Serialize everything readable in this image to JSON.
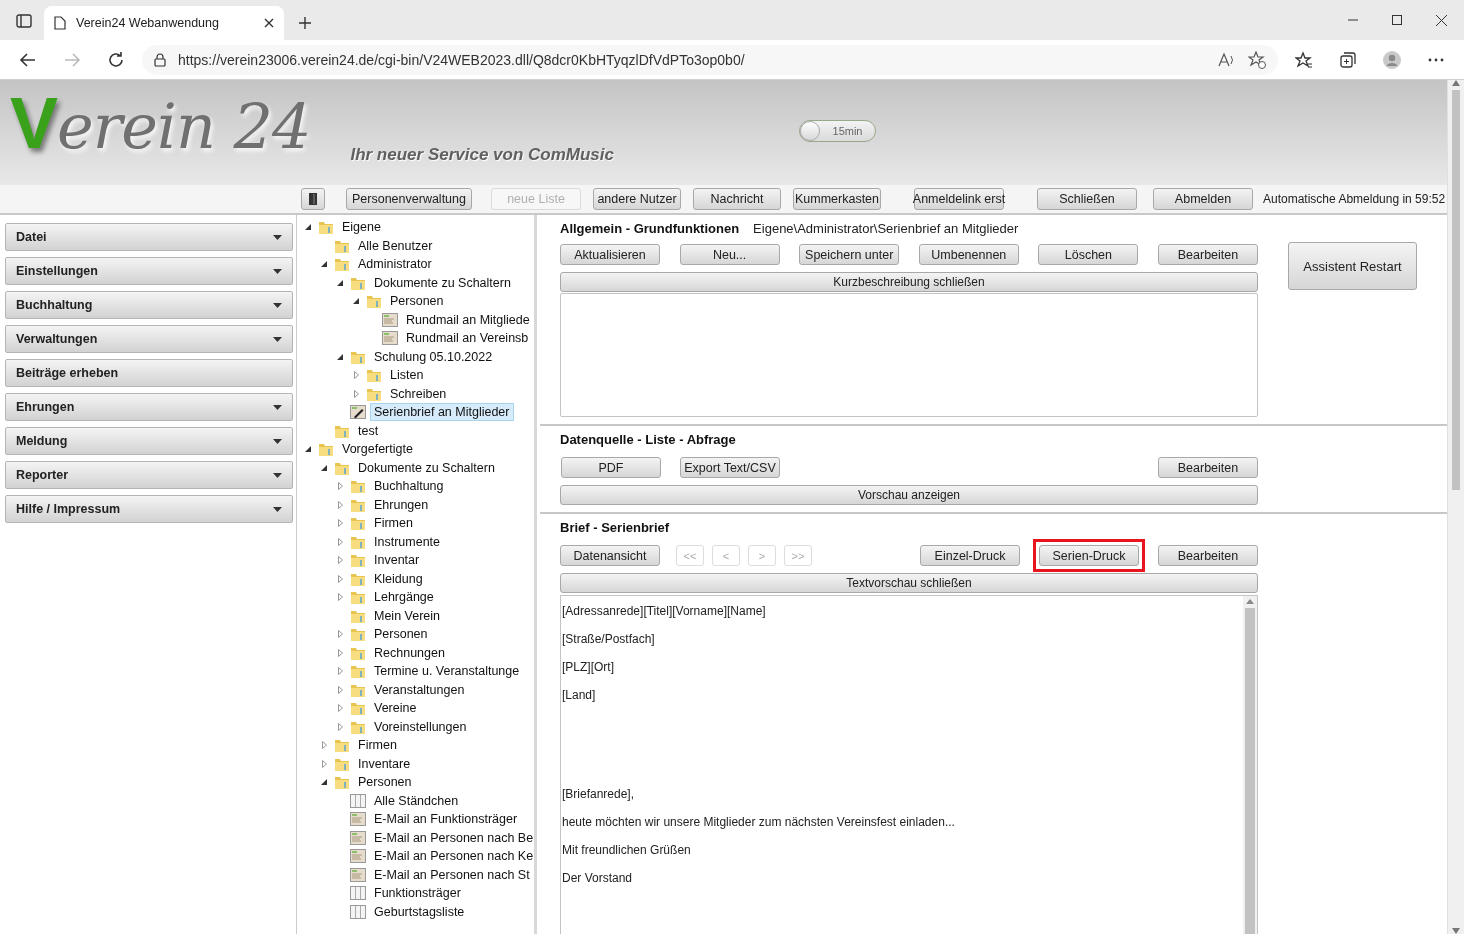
{
  "browser": {
    "tab_title": "Verein24 Webanwendung",
    "url": "https://verein23006.verein24.de/cgi-bin/V24WEB2023.dll/Q8dcr0KbHTyqzlDfVdPTo3op0b0/"
  },
  "header": {
    "logo_initial": "V",
    "logo_rest": "erein 24",
    "tagline": "Ihr neuer Service von ComMusic",
    "timeout_toggle": {
      "label": "15min",
      "on": false
    }
  },
  "toolbar": {
    "buttons": [
      {
        "kind": "icon",
        "disabled": false
      },
      {
        "kind": "text",
        "label": "Personenverwaltung",
        "disabled": false
      },
      {
        "kind": "text",
        "label": "neue Liste",
        "disabled": true
      },
      {
        "kind": "text",
        "label": "andere Nutzer",
        "disabled": false
      },
      {
        "kind": "text",
        "label": "Nachricht",
        "disabled": false
      },
      {
        "kind": "text",
        "label": "Kummerkasten",
        "disabled": false
      },
      {
        "kind": "text",
        "label": "Anmeldelink erst",
        "disabled": false
      },
      {
        "kind": "text",
        "label": "Schließen",
        "disabled": false
      },
      {
        "kind": "text",
        "label": "Abmelden",
        "disabled": false
      }
    ],
    "auto_logout": "Automatische Abmeldung in 59:52"
  },
  "menu": [
    {
      "label": "Datei",
      "has_submenu": true
    },
    {
      "label": "Einstellungen",
      "has_submenu": true
    },
    {
      "label": "Buchhaltung",
      "has_submenu": true
    },
    {
      "label": "Verwaltungen",
      "has_submenu": true
    },
    {
      "label": "Beiträge erheben",
      "has_submenu": false
    },
    {
      "label": "Ehrungen",
      "has_submenu": true
    },
    {
      "label": "Meldung",
      "has_submenu": true
    },
    {
      "label": "Reporter",
      "has_submenu": true
    },
    {
      "label": "Hilfe / Impressum",
      "has_submenu": true
    }
  ],
  "tree": [
    {
      "label": "Eigene",
      "kind": "folder",
      "expanded": true,
      "selected": false,
      "children": [
        {
          "label": "Alle Benutzer",
          "kind": "folder",
          "selected": false
        },
        {
          "label": "Administrator",
          "kind": "folder",
          "expanded": true,
          "selected": false,
          "children": [
            {
              "label": "Dokumente zu Schaltern",
              "kind": "folder",
              "expanded": true,
              "selected": false,
              "children": [
                {
                  "label": "Personen",
                  "kind": "folder",
                  "expanded": true,
                  "selected": false,
                  "children": [
                    {
                      "label": "Rundmail an Mitgliede",
                      "kind": "mail-template",
                      "selected": false
                    },
                    {
                      "label": "Rundmail an Vereinsb",
                      "kind": "mail-template",
                      "selected": false
                    }
                  ]
                }
              ]
            },
            {
              "label": "Schulung 05.10.2022",
              "kind": "folder",
              "expanded": true,
              "selected": false,
              "children": [
                {
                  "label": "Listen",
                  "kind": "folder",
                  "expanded": false,
                  "selected": false
                },
                {
                  "label": "Schreiben",
                  "kind": "folder",
                  "expanded": false,
                  "selected": false
                }
              ]
            },
            {
              "label": "Serienbrief an Mitglieder",
              "kind": "letter-edit",
              "selected": true
            }
          ]
        },
        {
          "label": "test",
          "kind": "folder",
          "selected": false
        }
      ]
    },
    {
      "label": "Vorgefertigte",
      "kind": "folder",
      "expanded": true,
      "selected": false,
      "children": [
        {
          "label": "Dokumente zu Schaltern",
          "kind": "folder",
          "expanded": true,
          "selected": false,
          "children": [
            {
              "label": "Buchhaltung",
              "kind": "folder",
              "expanded": false,
              "selected": false
            },
            {
              "label": "Ehrungen",
              "kind": "folder",
              "expanded": false,
              "selected": false
            },
            {
              "label": "Firmen",
              "kind": "folder",
              "expanded": false,
              "selected": false
            },
            {
              "label": "Instrumente",
              "kind": "folder",
              "expanded": false,
              "selected": false
            },
            {
              "label": "Inventar",
              "kind": "folder",
              "expanded": false,
              "selected": false
            },
            {
              "label": "Kleidung",
              "kind": "folder",
              "expanded": false,
              "selected": false
            },
            {
              "label": "Lehrgänge",
              "kind": "folder",
              "expanded": false,
              "selected": false
            },
            {
              "label": "Mein Verein",
              "kind": "folder",
              "selected": false
            },
            {
              "label": "Personen",
              "kind": "folder",
              "expanded": false,
              "selected": false
            },
            {
              "label": "Rechnungen",
              "kind": "folder",
              "expanded": false,
              "selected": false
            },
            {
              "label": "Termine u. Veranstaltunge",
              "kind": "folder",
              "expanded": false,
              "selected": false
            },
            {
              "label": "Veranstaltungen",
              "kind": "folder",
              "expanded": false,
              "selected": false
            },
            {
              "label": "Vereine",
              "kind": "folder",
              "expanded": false,
              "selected": false
            },
            {
              "label": "Voreinstellungen",
              "kind": "folder",
              "expanded": false,
              "selected": false
            }
          ]
        },
        {
          "label": "Firmen",
          "kind": "folder",
          "expanded": false,
          "selected": false
        },
        {
          "label": "Inventare",
          "kind": "folder",
          "expanded": false,
          "selected": false
        },
        {
          "label": "Personen",
          "kind": "folder",
          "expanded": true,
          "selected": false,
          "children": [
            {
              "label": "Alle Ständchen",
              "kind": "list",
              "selected": false
            },
            {
              "label": "E-Mail an Funktionsträger",
              "kind": "mail-template",
              "selected": false
            },
            {
              "label": "E-Mail an Personen nach Be",
              "kind": "mail-template",
              "selected": false
            },
            {
              "label": "E-Mail an Personen nach Ke",
              "kind": "mail-template",
              "selected": false
            },
            {
              "label": "E-Mail an Personen nach St",
              "kind": "mail-template",
              "selected": false
            },
            {
              "label": "Funktionsträger",
              "kind": "list",
              "selected": false
            },
            {
              "label": "Geburtstagsliste",
              "kind": "list",
              "selected": false
            }
          ]
        }
      ]
    }
  ],
  "general": {
    "title": "Allgemein - Grundfunktionen",
    "path": "Eigene\\Administrator\\Serienbrief an Mitglieder",
    "buttons": [
      {
        "label": "Aktualisieren"
      },
      {
        "label": "Neu..."
      },
      {
        "label": "Speichern unter"
      },
      {
        "label": "Umbenennen"
      },
      {
        "label": "Löschen"
      },
      {
        "label": "Bearbeiten"
      }
    ],
    "toggle_bar": "Kurzbeschreibung schließen",
    "assistant_button": "Assistent Restart"
  },
  "datasource": {
    "title": "Datenquelle - Liste - Abfrage",
    "buttons": [
      {
        "label": "PDF"
      },
      {
        "label": "Export Text/CSV"
      },
      {
        "label": "Bearbeiten"
      }
    ],
    "toggle_bar": "Vorschau anzeigen"
  },
  "letter": {
    "title": "Brief - Serienbrief",
    "buttons": [
      {
        "kind": "action",
        "label": "Datenansicht",
        "disabled": false,
        "highlighted": false
      },
      {
        "kind": "nav",
        "label": "<<",
        "disabled": true,
        "highlighted": false
      },
      {
        "kind": "nav",
        "label": "<",
        "disabled": true,
        "highlighted": false
      },
      {
        "kind": "nav",
        "label": ">",
        "disabled": true,
        "highlighted": false
      },
      {
        "kind": "nav",
        "label": ">>",
        "disabled": true,
        "highlighted": false
      },
      {
        "kind": "action",
        "label": "Einzel-Druck",
        "disabled": false,
        "highlighted": false
      },
      {
        "kind": "action",
        "label": "Serien-Druck",
        "disabled": false,
        "highlighted": true
      },
      {
        "kind": "action",
        "label": "Bearbeiten",
        "disabled": false,
        "highlighted": false
      }
    ],
    "toggle_bar": "Textvorschau schließen",
    "preview_lines": [
      {
        "text": "[Adressanrede][Titel][Vorname][Name]",
        "spaced": false
      },
      {
        "text": "[Straße/Postfach]",
        "spaced": false
      },
      {
        "text": "[PLZ][Ort]",
        "spaced": false
      },
      {
        "text": "[Land]",
        "spaced": false
      },
      {
        "text": "[Briefanrede],",
        "spaced": true
      },
      {
        "text": "heute möchten wir unsere Mitglieder zum nächsten Vereinsfest einladen...",
        "spaced": false
      },
      {
        "text": "Mit freundlichen Grüßen",
        "spaced": false
      },
      {
        "text": "Der Vorstand",
        "spaced": false
      }
    ]
  }
}
